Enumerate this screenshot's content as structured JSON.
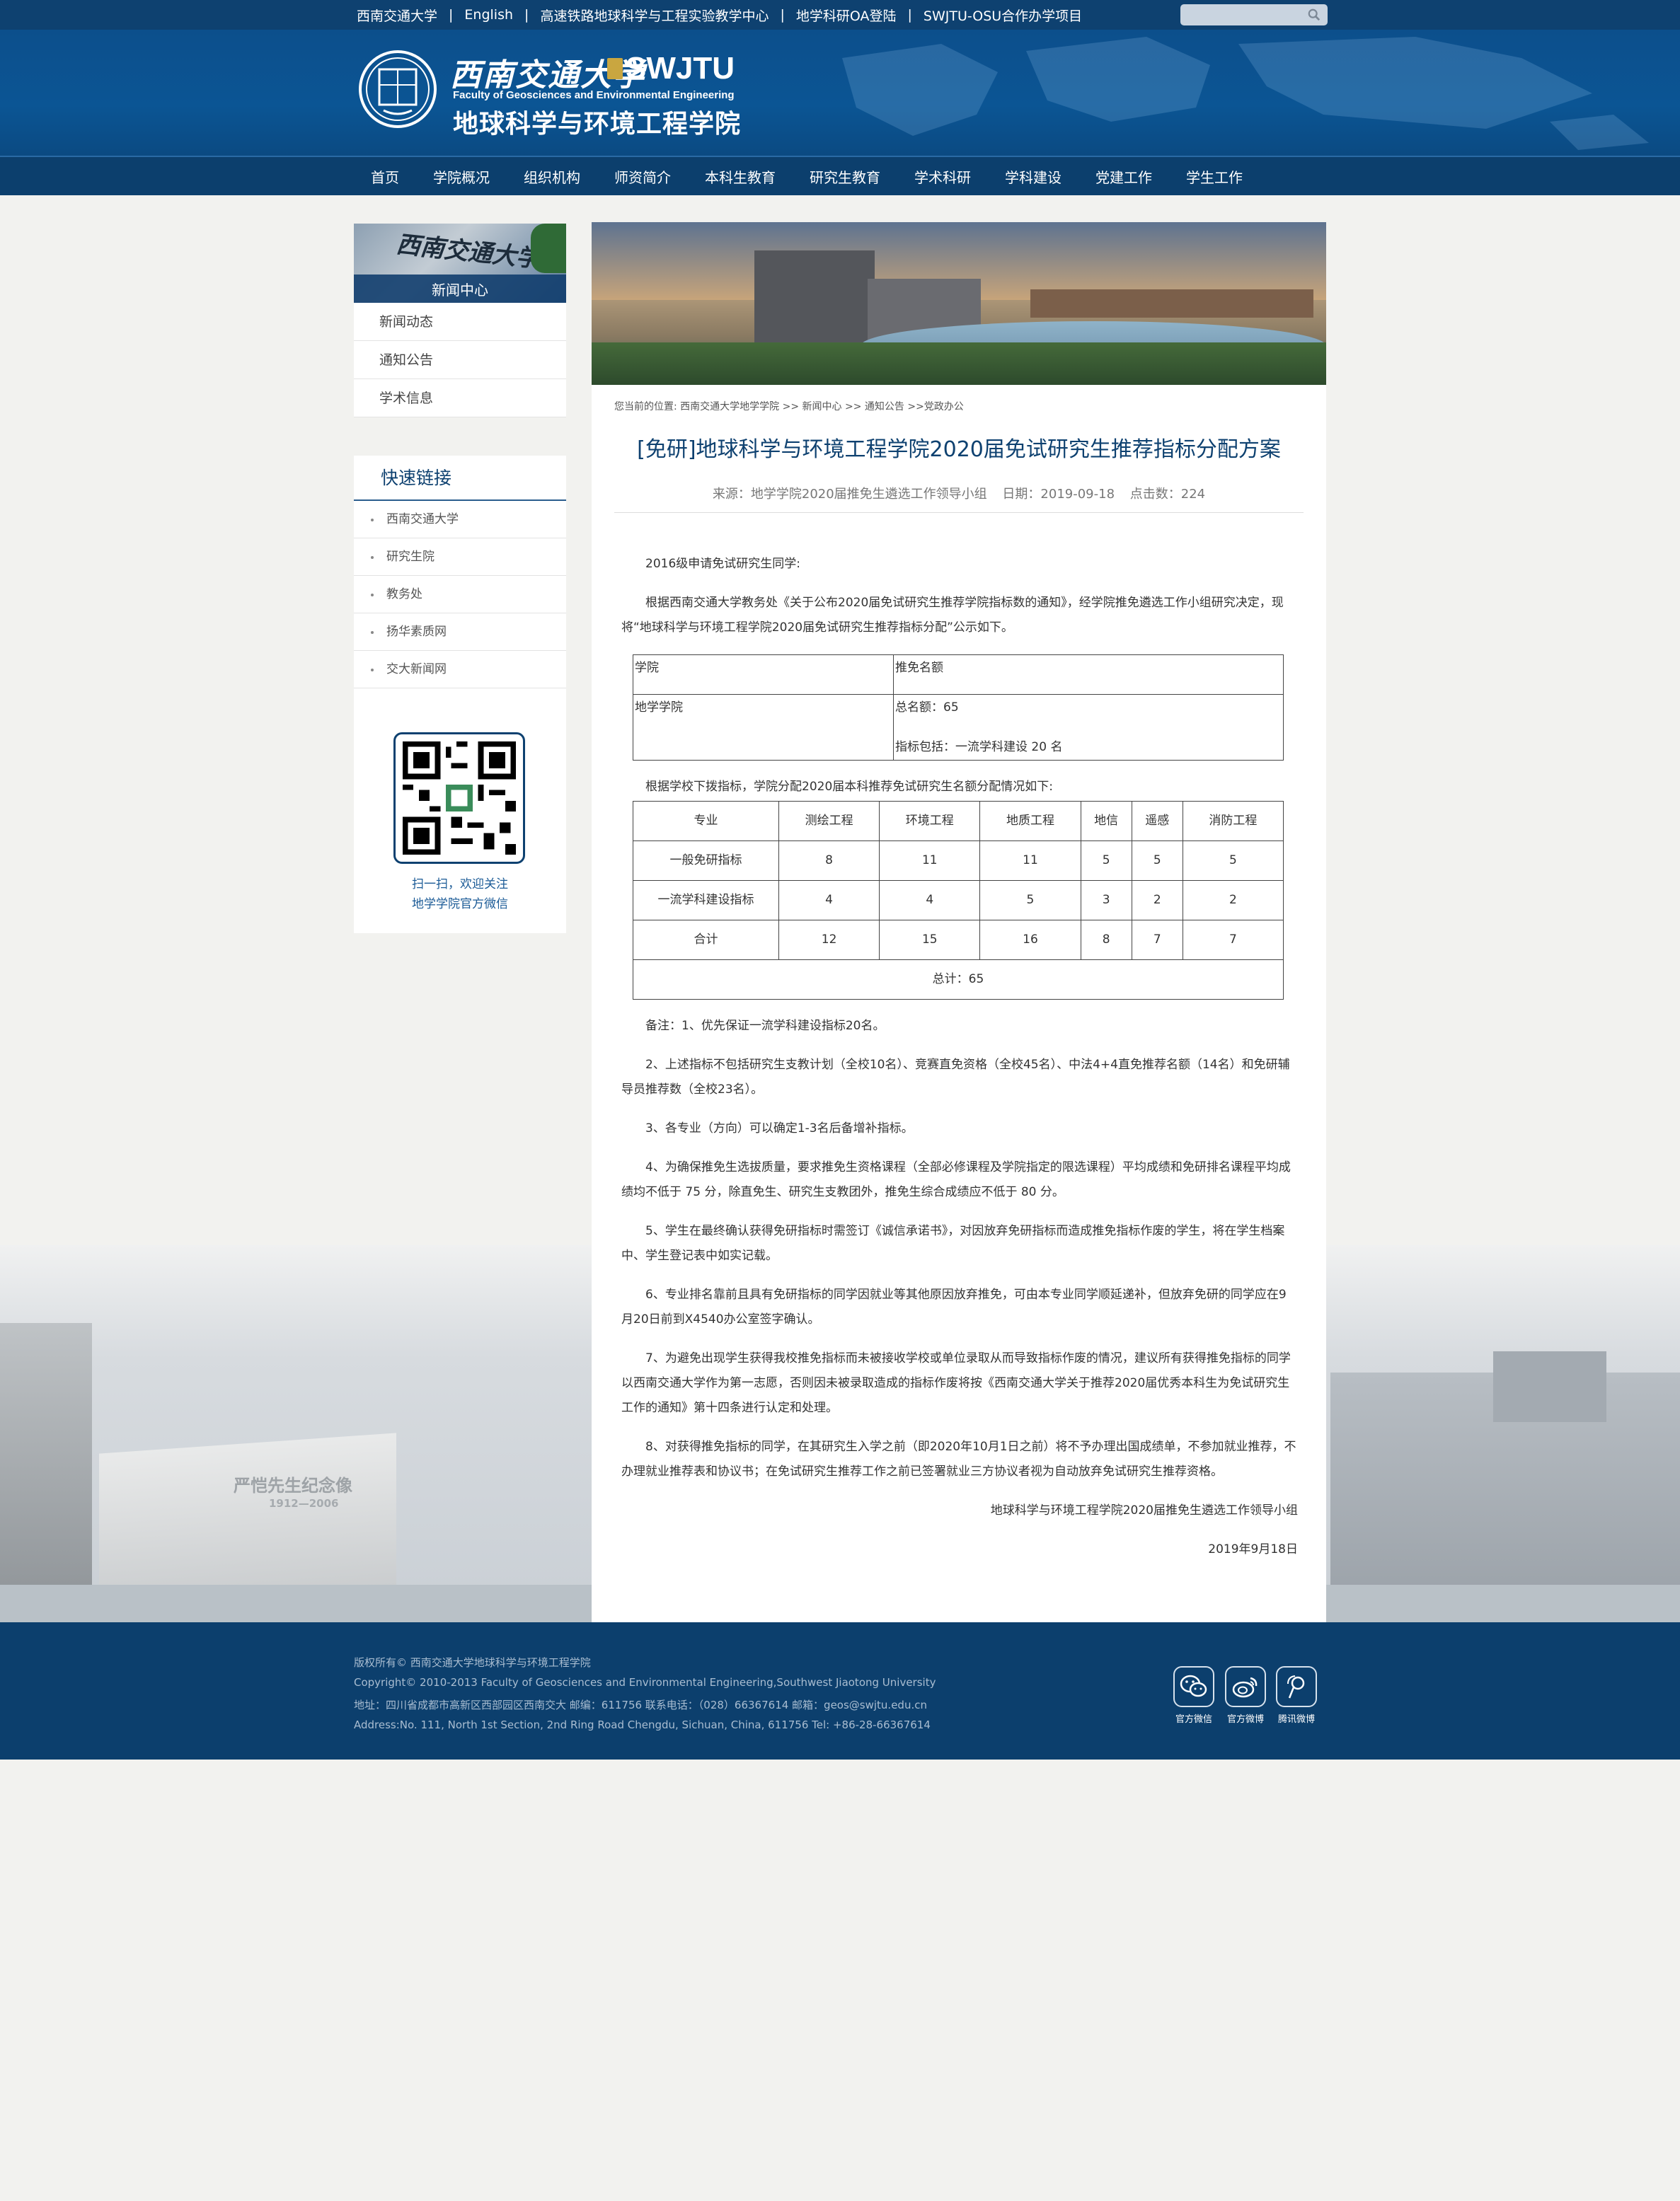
{
  "topbar": {
    "links": [
      "西南交通大学",
      "English",
      "高速铁路地球科学与工程实验教学中心",
      "地学科研OA登陆",
      "SWJTU-OSU合作办学项目"
    ],
    "separator": "|",
    "search_placeholder": ""
  },
  "header": {
    "logo_script": "西南交通大学",
    "logo_abbr": "SWJTU",
    "logo_en": "Faculty of Geosciences and Environmental Engineering",
    "logo_cn": "地球科学与环境工程学院"
  },
  "nav": [
    "首页",
    "学院概况",
    "组织机构",
    "师资简介",
    "本科生教育",
    "研究生教育",
    "学术科研",
    "学科建设",
    "党建工作",
    "学生工作"
  ],
  "sidebar": {
    "banner_script": "西南交通大学",
    "banner_label": "新闻中心",
    "items": [
      "新闻动态",
      "通知公告",
      "学术信息"
    ],
    "quick_title": "快速链接",
    "quick_links": [
      "西南交通大学",
      "研究生院",
      "教务处",
      "扬华素质网",
      "交大新闻网"
    ],
    "qr_text1": "扫一扫，欢迎关注",
    "qr_text2": "地学学院官方微信"
  },
  "article": {
    "breadcrumb": "您当前的位置: 西南交通大学地学学院 >> 新闻中心 >> 通知公告 >>党政办公",
    "title": "[免研]地球科学与环境工程学院2020届免试研究生推荐指标分配方案",
    "source": "来源：地学学院2020届推免生遴选工作领导小组",
    "date": "日期：2019-09-18",
    "clicks": "点击数：224",
    "greeting": "2016级申请免试研究生同学:",
    "intro": "根据西南交通大学教务处《关于公布2020届免试研究生推荐学院指标数的通知》，经学院推免遴选工作小组研究决定，现将“地球科学与环境工程学院2020届免试研究生推荐指标分配”公示如下。",
    "summary_table": {
      "h1": "学院",
      "h2": "推免名额",
      "r1": "地学学院",
      "r2a": "总名额：65",
      "r2b": "指标包括：一流学科建设 20 名"
    },
    "alloc_intro": "根据学校下拨指标，学院分配2020届本科推荐免试研究生名额分配情况如下:",
    "alloc_table": {
      "headers": [
        "专业",
        "测绘工程",
        "环境工程",
        "地质工程",
        "地信",
        "遥感",
        "消防工程"
      ],
      "rows": [
        [
          "一般免研指标",
          "8",
          "11",
          "11",
          "5",
          "5",
          "5"
        ],
        [
          "一流学科建设指标",
          "4",
          "4",
          "5",
          "3",
          "2",
          "2"
        ],
        [
          "合计",
          "12",
          "15",
          "16",
          "8",
          "7",
          "7"
        ]
      ],
      "total": "总计：65"
    },
    "notes": [
      "备注：1、优先保证一流学科建设指标20名。",
      "2、上述指标不包括研究生支教计划（全校10名）、竞赛直免资格（全校45名）、中法4+4直免推荐名额（14名）和免研辅导员推荐数（全校23名）。",
      "3、各专业（方向）可以确定1-3名后备增补指标。",
      "4、为确保推免生选拔质量，要求推免生资格课程（全部必修课程及学院指定的限选课程）平均成绩和免研排名课程平均成绩均不低于 75 分，除直免生、研究生支教团外，推免生综合成绩应不低于 80 分。",
      "5、学生在最终确认获得免研指标时需签订《诚信承诺书》，对因放弃免研指标而造成推免指标作废的学生，将在学生档案中、学生登记表中如实记载。",
      "6、专业排名靠前且具有免研指标的同学因就业等其他原因放弃推免，可由本专业同学顺延递补，但放弃免研的同学应在9月20日前到X4540办公室签字确认。",
      "7、为避免出现学生获得我校推免指标而未被接收学校或单位录取从而导致指标作废的情况，建议所有获得推免指标的同学以西南交通大学作为第一志愿，否则因未被录取造成的指标作废将按《西南交通大学关于推荐2020届优秀本科生为免试研究生工作的通知》第十四条进行认定和处理。",
      "8、对获得推免指标的同学，在其研究生入学之前（即2020年10月1日之前）将不予办理出国成绩单，不参加就业推荐，不办理就业推荐表和协议书；在免试研究生推荐工作之前已签署就业三方协议者视为自动放弃免试研究生推荐资格。"
    ],
    "signature": "地球科学与环境工程学院2020届推免生遴选工作领导小组",
    "sign_date": "2019年9月18日"
  },
  "background": {
    "plinth_text": "严恺先生纪念像",
    "plinth_years": "1912—2006"
  },
  "footer": {
    "line1": "版权所有© 西南交通大学地球科学与环境工程学院",
    "line2": "Copyright© 2010-2013 Faculty of Geosciences and Environmental Engineering,Southwest Jiaotong University",
    "line3": "地址：四川省成都市高新区西部园区西南交大 邮编：611756 联系电话：（028）66367614 邮箱：geos@swjtu.edu.cn",
    "line4": "Address:No. 111, North 1st Section, 2nd Ring Road Chengdu, Sichuan, China, 611756 Tel: +86-28-66367614",
    "social": [
      "官方微信",
      "官方微博",
      "腾讯微博"
    ]
  },
  "colors": {
    "primary": "#0e4170",
    "nav": "#0c3f6d",
    "title": "#0e4170"
  },
  "icons": [
    "search-icon",
    "wechat-icon",
    "weibo-icon",
    "tencent-weibo-icon",
    "qr-code-icon",
    "university-emblem-icon"
  ]
}
